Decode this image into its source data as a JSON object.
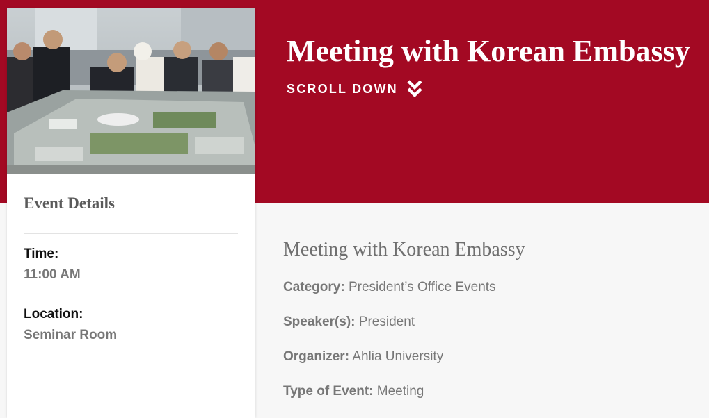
{
  "banner": {
    "title": "Meeting with Korean Embassy",
    "scroll_label": "SCROLL DOWN",
    "scroll_icon": "double-chevron-down-icon",
    "color": "#a30923"
  },
  "sidebar": {
    "heading": "Event Details",
    "time_label": "Time:",
    "time_value": "11:00 AM",
    "location_label": "Location:",
    "location_value": "Seminar Room"
  },
  "main": {
    "heading": "Meeting with Korean Embassy",
    "rows": [
      {
        "label": "Category:",
        "value": "President’s Office Events"
      },
      {
        "label": "Speaker(s):",
        "value": "President"
      },
      {
        "label": "Organizer:",
        "value": "Ahlia University"
      },
      {
        "label": "Type of Event:",
        "value": "Meeting"
      }
    ]
  }
}
